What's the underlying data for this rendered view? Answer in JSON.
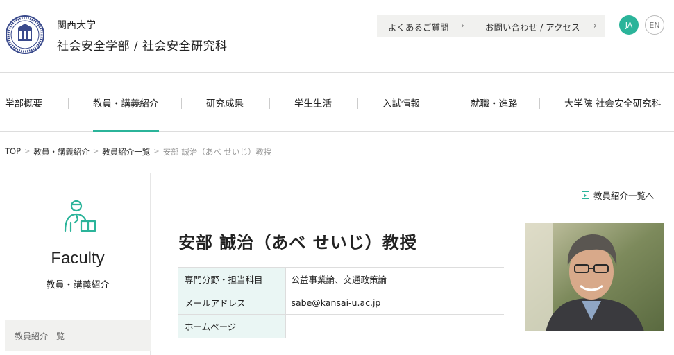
{
  "header": {
    "university": "関西大学",
    "faculty": "社会安全学部 / 社会安全研究科",
    "util_nav": [
      {
        "label": "よくあるご質問",
        "chevron": "›"
      },
      {
        "label": "お問い合わせ / アクセス",
        "chevron": "›"
      }
    ],
    "lang_ja": "JA",
    "lang_en": "EN",
    "accent_color": "#2bb49a"
  },
  "gnav": [
    {
      "label": "学部概要"
    },
    {
      "label": "教員・講義紹介"
    },
    {
      "label": "研究成果"
    },
    {
      "label": "学生生活"
    },
    {
      "label": "入試情報"
    },
    {
      "label": "就職・進路"
    },
    {
      "label": "大学院 社会安全研究科"
    }
  ],
  "breadcrumb": [
    {
      "label": "TOP"
    },
    {
      "label": "教員・講義紹介"
    },
    {
      "label": "教員紹介一覧"
    },
    {
      "label": "安部 誠治（あべ せいじ）教授"
    }
  ],
  "side": {
    "icon": "teacher-with-book-icon",
    "title": "Faculty",
    "subtitle": "教員・講義紹介",
    "menu": [
      {
        "label": "教員紹介一覧"
      }
    ]
  },
  "main": {
    "back_link": "教員紹介一覧へ",
    "name": "安部 誠治（あべ せいじ）教授",
    "info": [
      {
        "label": "専門分野・担当科目",
        "value": "公益事業論、交通政策論"
      },
      {
        "label": "メールアドレス",
        "value": "sabe@kansai-u.ac.jp"
      },
      {
        "label": "ホームページ",
        "value": "–"
      }
    ]
  }
}
